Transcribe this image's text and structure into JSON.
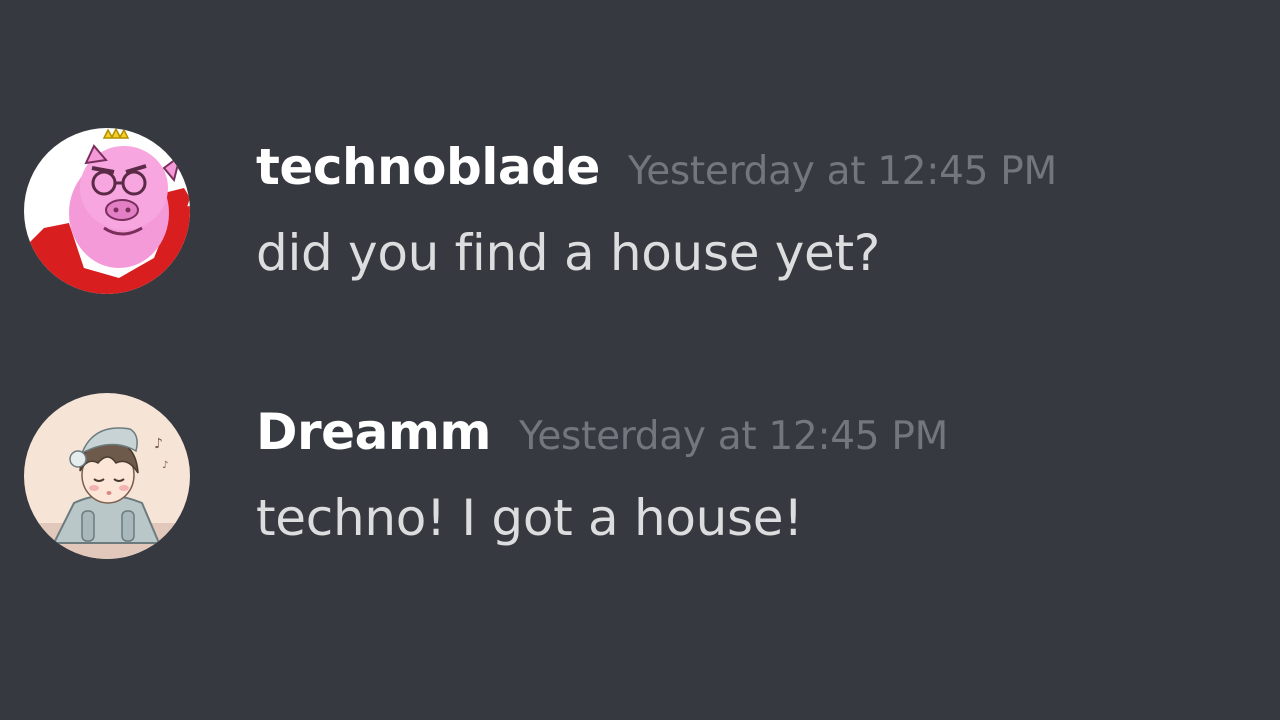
{
  "colors": {
    "background": "#36393f",
    "username": "#ffffff",
    "timestamp": "#72767d",
    "message_text": "#dcddde"
  },
  "messages": [
    {
      "username": "technoblade",
      "timestamp": "Yesterday at 12:45 PM",
      "text": "did you find a house yet?",
      "avatar_icon": "pig-with-crown-avatar"
    },
    {
      "username": "Dreamm",
      "timestamp": "Yesterday at 12:45 PM",
      "text": "techno! I got a house!",
      "avatar_icon": "sleepy-boy-avatar"
    }
  ]
}
